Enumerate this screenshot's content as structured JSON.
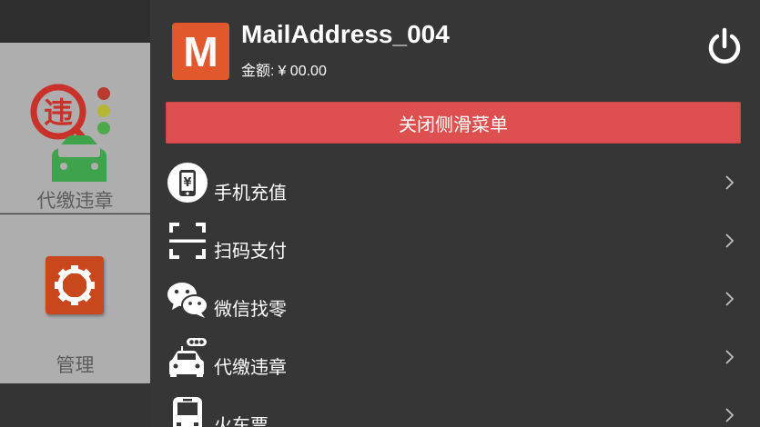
{
  "background": {
    "tiles": [
      {
        "label": "代缴违章",
        "icon": "violation-traffic-light-car-icon"
      },
      {
        "label": "管理",
        "icon": "gear-icon"
      }
    ]
  },
  "drawer": {
    "avatar_letter": "M",
    "username": "MailAddress_004",
    "balance_label": "金额:",
    "balance_value": "¥ 00.00",
    "close_button_label": "关闭侧滑菜单",
    "menu": [
      {
        "label": "手机充值",
        "icon": "phone-recharge-icon"
      },
      {
        "label": "扫码支付",
        "icon": "scan-icon"
      },
      {
        "label": "微信找零",
        "icon": "wechat-icon"
      },
      {
        "label": "代缴违章",
        "icon": "car-traffic-light-icon"
      },
      {
        "label": "火车票",
        "icon": "train-icon"
      }
    ]
  },
  "colors": {
    "accent_red": "#de5050",
    "avatar_orange": "#e1582c",
    "drawer_bg": "#363636"
  }
}
